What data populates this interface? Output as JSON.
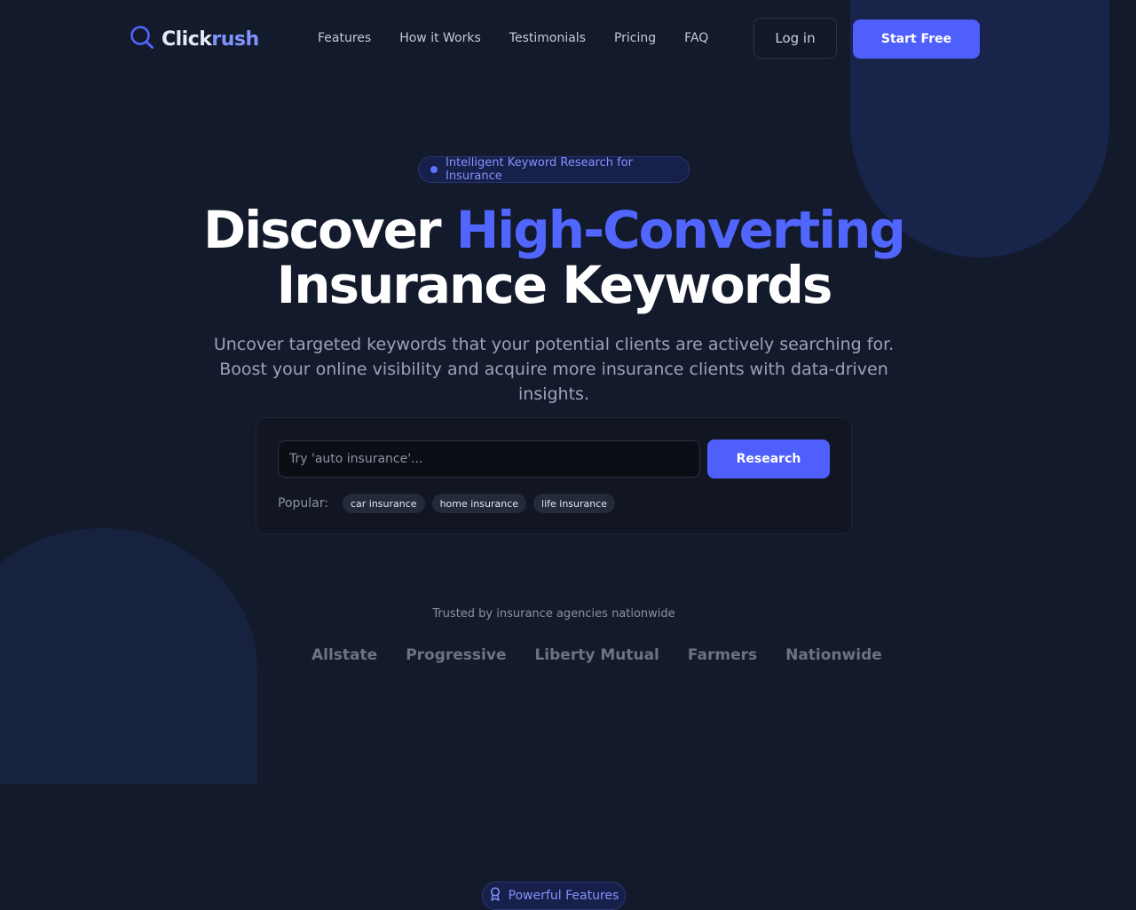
{
  "brand": {
    "name_part1": "Click",
    "name_part2": "rush",
    "logo_icon": "search-icon"
  },
  "nav": {
    "links": [
      "Features",
      "How it Works",
      "Testimonials",
      "Pricing",
      "FAQ"
    ],
    "login_label": "Log in",
    "start_label": "Start Free"
  },
  "hero": {
    "pill_text": "Intelligent Keyword Research for Insurance",
    "title_part1": "Discover ",
    "title_highlight": "High-Converting",
    "title_line2": "Insurance Keywords",
    "subtitle": "Uncover targeted keywords that your potential clients are actively searching for. Boost your online visibility and acquire more insurance clients with data-driven insights."
  },
  "search": {
    "placeholder": "Try 'auto insurance'...",
    "button_label": "Research",
    "popular_label": "Popular:",
    "popular_tags": [
      "car insurance",
      "home insurance",
      "life insurance"
    ]
  },
  "trusted": {
    "label": "Trusted by insurance agencies nationwide",
    "brands": [
      "Allstate",
      "Progressive",
      "Liberty Mutual",
      "Farmers",
      "Nationwide"
    ]
  },
  "features": {
    "pill_text": "Powerful Features",
    "pill_icon": "award-icon"
  },
  "colors": {
    "background": "#131a2b",
    "accent": "#4e5ffb",
    "highlight": "#5166ff"
  }
}
